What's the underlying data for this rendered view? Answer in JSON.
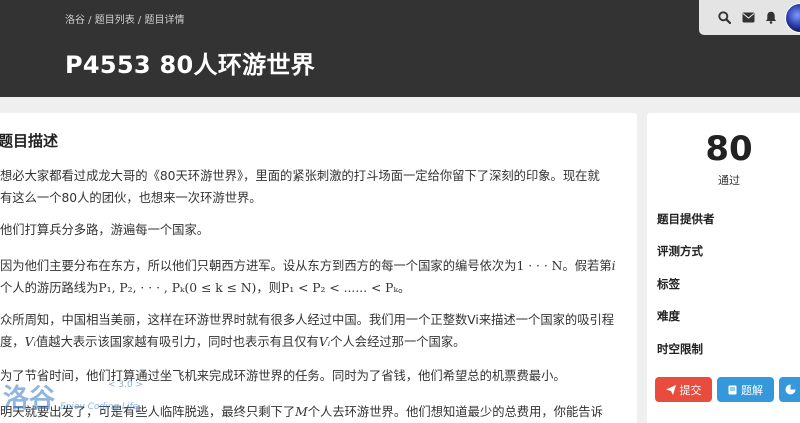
{
  "breadcrumb": {
    "home": "洛谷",
    "sep1": " / ",
    "list": "题目列表",
    "sep2": " / ",
    "current": "题目详情"
  },
  "problem": {
    "title": "P4553 80人环游世界"
  },
  "toolbar": {
    "icons": [
      "search-icon",
      "envelope-icon",
      "bell-icon",
      "avatar"
    ]
  },
  "description": {
    "heading": "题目描述",
    "p1a": "想必大家都看过成龙大哥的《80天环游世界》，里面的紧张刺激的打斗场面一定给你留下了深刻的印象。现在就",
    "p1b": "有这么一个80人的团伙，也想来一次环游世界。",
    "p2": "他们打算兵分多路，游遍每一个国家。",
    "p3a_pre": "因为他们主要分布在东方，所以他们只朝西方进军。设从东方到西方的每一个国家的编号依次为",
    "p3a_math": "1 · · · N",
    "p3a_mid": "。假若第",
    "p3a_i": "i",
    "p3b_pre": "个人的游历路线为",
    "p3b_math": "P₁, P₂, · · · , Pₖ(0 ≤ k ≤ N)",
    "p3b_mid": "，则",
    "p3b_math2": "P₁ < P₂ < ...... < Pₖ",
    "p3b_end": "。",
    "p4a": "众所周知，中国相当美丽，这样在环游世界时就有很多人经过中国。我们用一个正整数Vi来描述一个国家的吸引程",
    "p4b_pre": "度，",
    "p4b_v1": "Vᵢ",
    "p4b_mid": "值越大表示该国家越有吸引力，同时也表示有且仅有",
    "p4b_v2": "Vᵢ",
    "p4b_end": "个人会经过那一个国家。",
    "p5": "为了节省时间，他们打算通过坐飞机来完成环游世界的任务。同时为了省钱，他们希望总的机票费最小。",
    "p6_pre": "明天就要出发了，可是有些人临阵脱逃，最终只剩下了",
    "p6_m": "M",
    "p6_end": "个人去环游世界。他们想知道最少的总费用，你能告诉"
  },
  "sidebar": {
    "pass_count": "80",
    "pass_label": "通过",
    "rows": [
      "题目提供者",
      "评测方式",
      "标签",
      "难度",
      "时空限制"
    ],
    "buttons": {
      "submit": "提交",
      "solution": "题解"
    }
  },
  "watermark": {
    "logo": "洛谷",
    "version": "< 3.0 >",
    "slogan": "Enjoy Coding Life"
  },
  "colors": {
    "header": "#333333",
    "submit": "#e74c3c",
    "solution": "#3498db"
  }
}
